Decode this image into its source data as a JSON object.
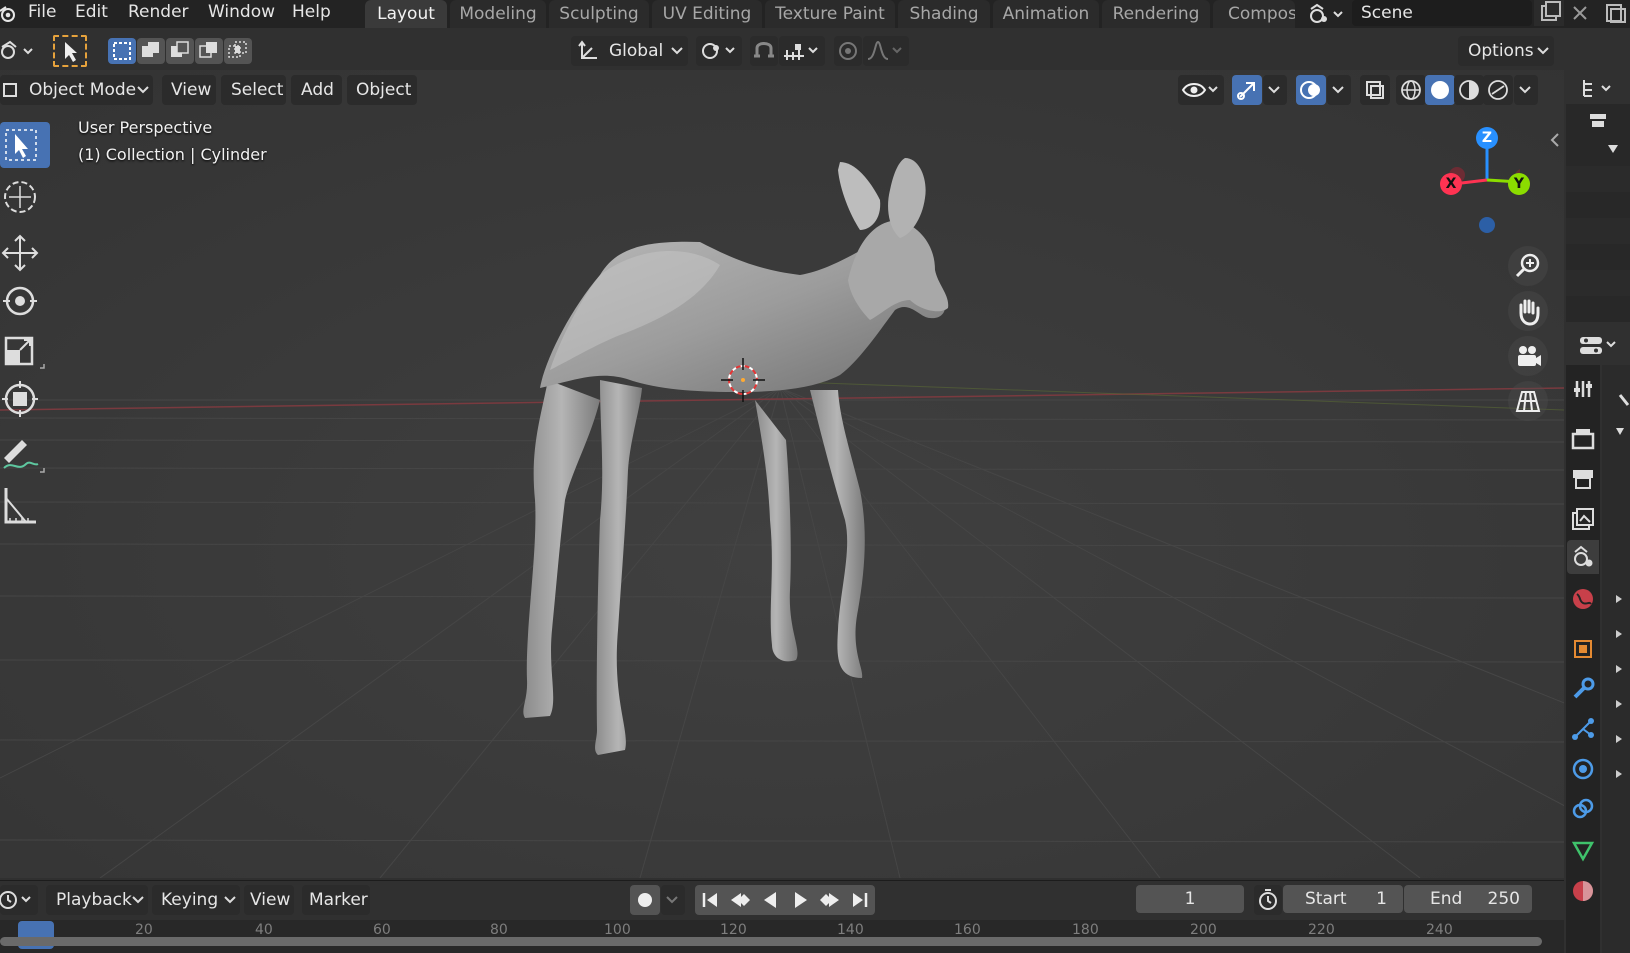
{
  "menu": {
    "items": [
      "File",
      "Edit",
      "Render",
      "Window",
      "Help"
    ]
  },
  "workspaces": [
    "Layout",
    "Modeling",
    "Sculpting",
    "UV Editing",
    "Texture Paint",
    "Shading",
    "Animation",
    "Rendering",
    "Compos"
  ],
  "active_workspace": "Layout",
  "scene": {
    "name": "Scene"
  },
  "tool_header": {
    "orientation": "Global",
    "options_label": "Options"
  },
  "viewport_header": {
    "mode": "Object Mode",
    "menus": [
      "View",
      "Select",
      "Add",
      "Object"
    ]
  },
  "viewport": {
    "perspective": "User Perspective",
    "collection_info": "(1) Collection | Cylinder"
  },
  "gizmo": {
    "x": "X",
    "y": "Y",
    "z": "Z"
  },
  "timeline": {
    "menus": [
      "Playback",
      "Keying",
      "View",
      "Marker"
    ],
    "current_frame": "1",
    "start_label": "Start",
    "start_value": "1",
    "end_label": "End",
    "end_value": "250",
    "ruler_ticks": [
      "20",
      "40",
      "60",
      "80",
      "100",
      "120",
      "140",
      "160",
      "180",
      "200",
      "220",
      "240"
    ]
  },
  "colors": {
    "accent_blue": "#4772b3",
    "axis_x": "#ff3352",
    "axis_y": "#8bdc00",
    "axis_z": "#2890ff",
    "background": "#393939"
  }
}
